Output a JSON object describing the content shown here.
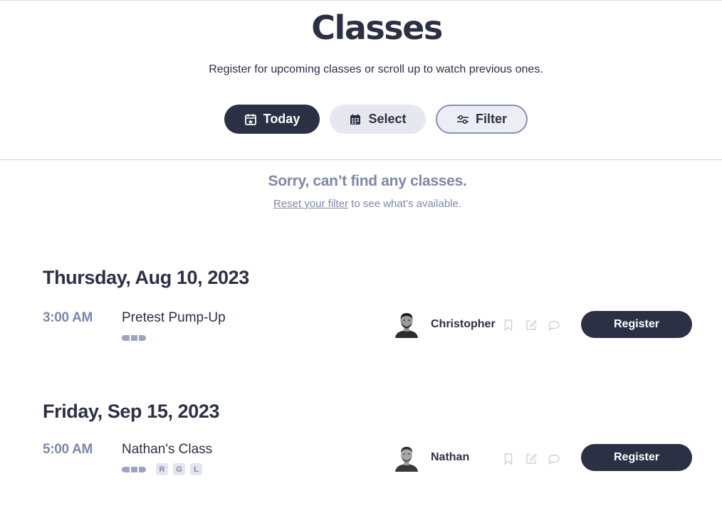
{
  "header": {
    "title": "Classes",
    "subtitle": "Register for upcoming classes or scroll up to watch previous ones."
  },
  "controls": {
    "today_label": "Today",
    "select_label": "Select",
    "filter_label": "Filter"
  },
  "empty_state": {
    "title": "Sorry, can’t find any classes.",
    "reset_link": "Reset your filter",
    "suffix": " to see what’s available."
  },
  "days": [
    {
      "heading": "Thursday, Aug 10, 2023",
      "classes": [
        {
          "time": "3:00 AM",
          "name": "Pretest Pump-Up",
          "tags": [],
          "instructor": "Christopher",
          "register_label": "Register"
        }
      ]
    },
    {
      "heading": "Friday, Sep 15, 2023",
      "classes": [
        {
          "time": "5:00 AM",
          "name": "Nathan's Class",
          "tags": [
            "R",
            "G",
            "L"
          ],
          "instructor": "Nathan",
          "register_label": "Register"
        }
      ]
    }
  ],
  "icons": {
    "today": "calendar-star-icon",
    "select": "calendar-grid-icon",
    "filter": "sliders-icon",
    "bookmark": "bookmark-icon",
    "edit": "edit-icon",
    "comment": "comment-icon"
  },
  "colors": {
    "primary": "#2b3045",
    "muted": "#7d87ab",
    "light": "#e6e8f0"
  }
}
